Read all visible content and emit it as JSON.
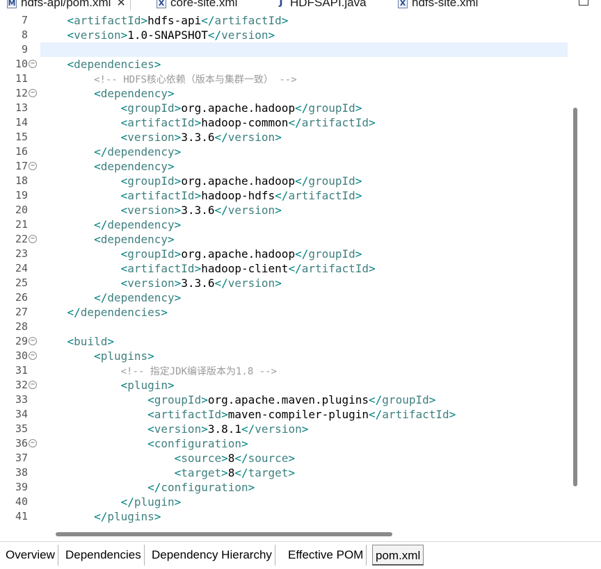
{
  "top_tabs": [
    {
      "label": "hdfs-api/pom.xml",
      "icon": "maven-pom-icon",
      "active": true,
      "close": "✕"
    },
    {
      "label": "core-site.xml",
      "icon": "xml-file-icon"
    },
    {
      "label": "HDFSAPI.java",
      "icon": "java-file-icon"
    },
    {
      "label": "hdfs-site.xml",
      "icon": "xml-file-icon"
    }
  ],
  "editor": {
    "lines": [
      {
        "n": "7",
        "fold": false,
        "text": "    <artifactId>hdfs-api</artifactId>"
      },
      {
        "n": "8",
        "fold": false,
        "text": "    <version>1.0-SNAPSHOT</version>"
      },
      {
        "n": "9",
        "fold": false,
        "text": "",
        "current": true
      },
      {
        "n": "10",
        "fold": true,
        "text": "    <dependencies>"
      },
      {
        "n": "11",
        "fold": false,
        "text": "        <!-- HDFS核心依赖（版本与集群一致） -->"
      },
      {
        "n": "12",
        "fold": true,
        "text": "        <dependency>"
      },
      {
        "n": "13",
        "fold": false,
        "text": "            <groupId>org.apache.hadoop</groupId>"
      },
      {
        "n": "14",
        "fold": false,
        "text": "            <artifactId>hadoop-common</artifactId>"
      },
      {
        "n": "15",
        "fold": false,
        "text": "            <version>3.3.6</version>"
      },
      {
        "n": "16",
        "fold": false,
        "text": "        </dependency>"
      },
      {
        "n": "17",
        "fold": true,
        "text": "        <dependency>"
      },
      {
        "n": "18",
        "fold": false,
        "text": "            <groupId>org.apache.hadoop</groupId>"
      },
      {
        "n": "19",
        "fold": false,
        "text": "            <artifactId>hadoop-hdfs</artifactId>"
      },
      {
        "n": "20",
        "fold": false,
        "text": "            <version>3.3.6</version>"
      },
      {
        "n": "21",
        "fold": false,
        "text": "        </dependency>"
      },
      {
        "n": "22",
        "fold": true,
        "text": "        <dependency>"
      },
      {
        "n": "23",
        "fold": false,
        "text": "            <groupId>org.apache.hadoop</groupId>"
      },
      {
        "n": "24",
        "fold": false,
        "text": "            <artifactId>hadoop-client</artifactId>"
      },
      {
        "n": "25",
        "fold": false,
        "text": "            <version>3.3.6</version>"
      },
      {
        "n": "26",
        "fold": false,
        "text": "        </dependency>"
      },
      {
        "n": "27",
        "fold": false,
        "text": "    </dependencies>"
      },
      {
        "n": "28",
        "fold": false,
        "text": ""
      },
      {
        "n": "29",
        "fold": true,
        "text": "    <build>"
      },
      {
        "n": "30",
        "fold": true,
        "text": "        <plugins>"
      },
      {
        "n": "31",
        "fold": false,
        "text": "            <!-- 指定JDK编译版本为1.8 -->"
      },
      {
        "n": "32",
        "fold": true,
        "text": "            <plugin>"
      },
      {
        "n": "33",
        "fold": false,
        "text": "                <groupId>org.apache.maven.plugins</groupId>"
      },
      {
        "n": "34",
        "fold": false,
        "text": "                <artifactId>maven-compiler-plugin</artifactId>"
      },
      {
        "n": "35",
        "fold": false,
        "text": "                <version>3.8.1</version>"
      },
      {
        "n": "36",
        "fold": true,
        "text": "                <configuration>"
      },
      {
        "n": "37",
        "fold": false,
        "text": "                    <source>8</source>"
      },
      {
        "n": "38",
        "fold": false,
        "text": "                    <target>8</target>"
      },
      {
        "n": "39",
        "fold": false,
        "text": "                </configuration>"
      },
      {
        "n": "40",
        "fold": false,
        "text": "            </plugin>"
      },
      {
        "n": "41",
        "fold": false,
        "text": "        </plugins>"
      }
    ]
  },
  "bottom_tabs": [
    {
      "label": "Overview"
    },
    {
      "label": "Dependencies"
    },
    {
      "label": "Dependency Hierarchy"
    },
    {
      "label": "Effective POM"
    },
    {
      "label": "pom.xml",
      "active": true
    }
  ],
  "colors": {
    "tag_bracket": "#008080",
    "tag_name": "#3f7f7f",
    "comment": "#9a9a9a",
    "current_line": "#e8f2fe"
  }
}
